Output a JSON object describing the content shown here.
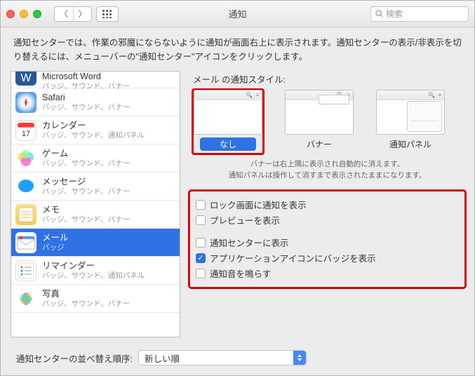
{
  "window": {
    "title": "通知",
    "search_placeholder": "検索"
  },
  "description": "通知センターでは、作業の邪魔にならないように通知が画面右上に表示されます。通知センターの表示/非表示を切り替えるには、メニューバーの\"通知センター\"アイコンをクリックします。",
  "sidebar": {
    "items": [
      {
        "title": "Microsoft Word",
        "sub": "バッジ、サウンド、バナー"
      },
      {
        "title": "Safari",
        "sub": "バッジ、サウンド、バナー"
      },
      {
        "title": "カレンダー",
        "sub": "バッジ、サウンド、通知パネル"
      },
      {
        "title": "ゲーム",
        "sub": "バッジ、サウンド、バナー"
      },
      {
        "title": "メッセージ",
        "sub": "バッジ、サウンド、バナー"
      },
      {
        "title": "メモ",
        "sub": "バッジ、サウンド、バナー"
      },
      {
        "title": "メール",
        "sub": "バッジ"
      },
      {
        "title": "リマインダー",
        "sub": "バッジ、サウンド、通知パネル"
      },
      {
        "title": "写真",
        "sub": "バッジ、サウンド、バナー"
      }
    ],
    "selected_index": 6
  },
  "right": {
    "style_title": "メール の通知スタイル:",
    "styles": [
      {
        "label": "なし",
        "selected": true
      },
      {
        "label": "バナー",
        "selected": false
      },
      {
        "label": "通知パネル",
        "selected": false
      }
    ],
    "hint_line1": "バナーは右上隅に表示され自動的に消えます。",
    "hint_line2": "通知パネルは操作して消すまで表示されたままになります。",
    "options": [
      {
        "label": "ロック画面に通知を表示",
        "checked": false
      },
      {
        "label": "プレビューを表示",
        "checked": false
      },
      {
        "label": "通知センターに表示",
        "checked": false
      },
      {
        "label": "アプリケーションアイコンにバッジを表示",
        "checked": true
      },
      {
        "label": "通知音を鳴らす",
        "checked": false
      }
    ]
  },
  "footer": {
    "label": "通知センターの並べ替え順序:",
    "value": "新しい順"
  }
}
